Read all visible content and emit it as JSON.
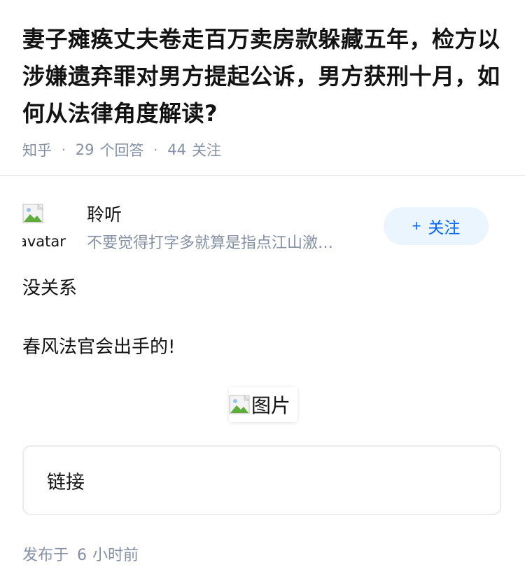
{
  "question": {
    "title": "妻子瘫痪丈夫卷走百万卖房款躲藏五年，检方以涉嫌遗弃罪对男方提起公诉，男方获刑十月，如何从法律角度解读?",
    "source": "知乎",
    "answer_count": "29",
    "answer_label": "个回答",
    "follow_count": "44",
    "follow_label": "关注"
  },
  "author": {
    "avatar_alt": "avatar",
    "name": "聆听",
    "bio": "不要觉得打字多就算是指点江山激…",
    "follow_button": "关注",
    "follow_icon": "plus-icon"
  },
  "answer": {
    "paragraphs": [
      "没关系",
      "春风法官会出手的!"
    ],
    "image_alt": "图片",
    "link_card": "链接"
  },
  "footer": {
    "published_prefix": "发布于",
    "published_num": "6",
    "published_suffix": "小时前"
  },
  "colors": {
    "text": "#121212",
    "muted": "#8590a6",
    "accent": "#0066ff",
    "follow_bg": "#ebf5fd",
    "border": "#ebebeb"
  }
}
